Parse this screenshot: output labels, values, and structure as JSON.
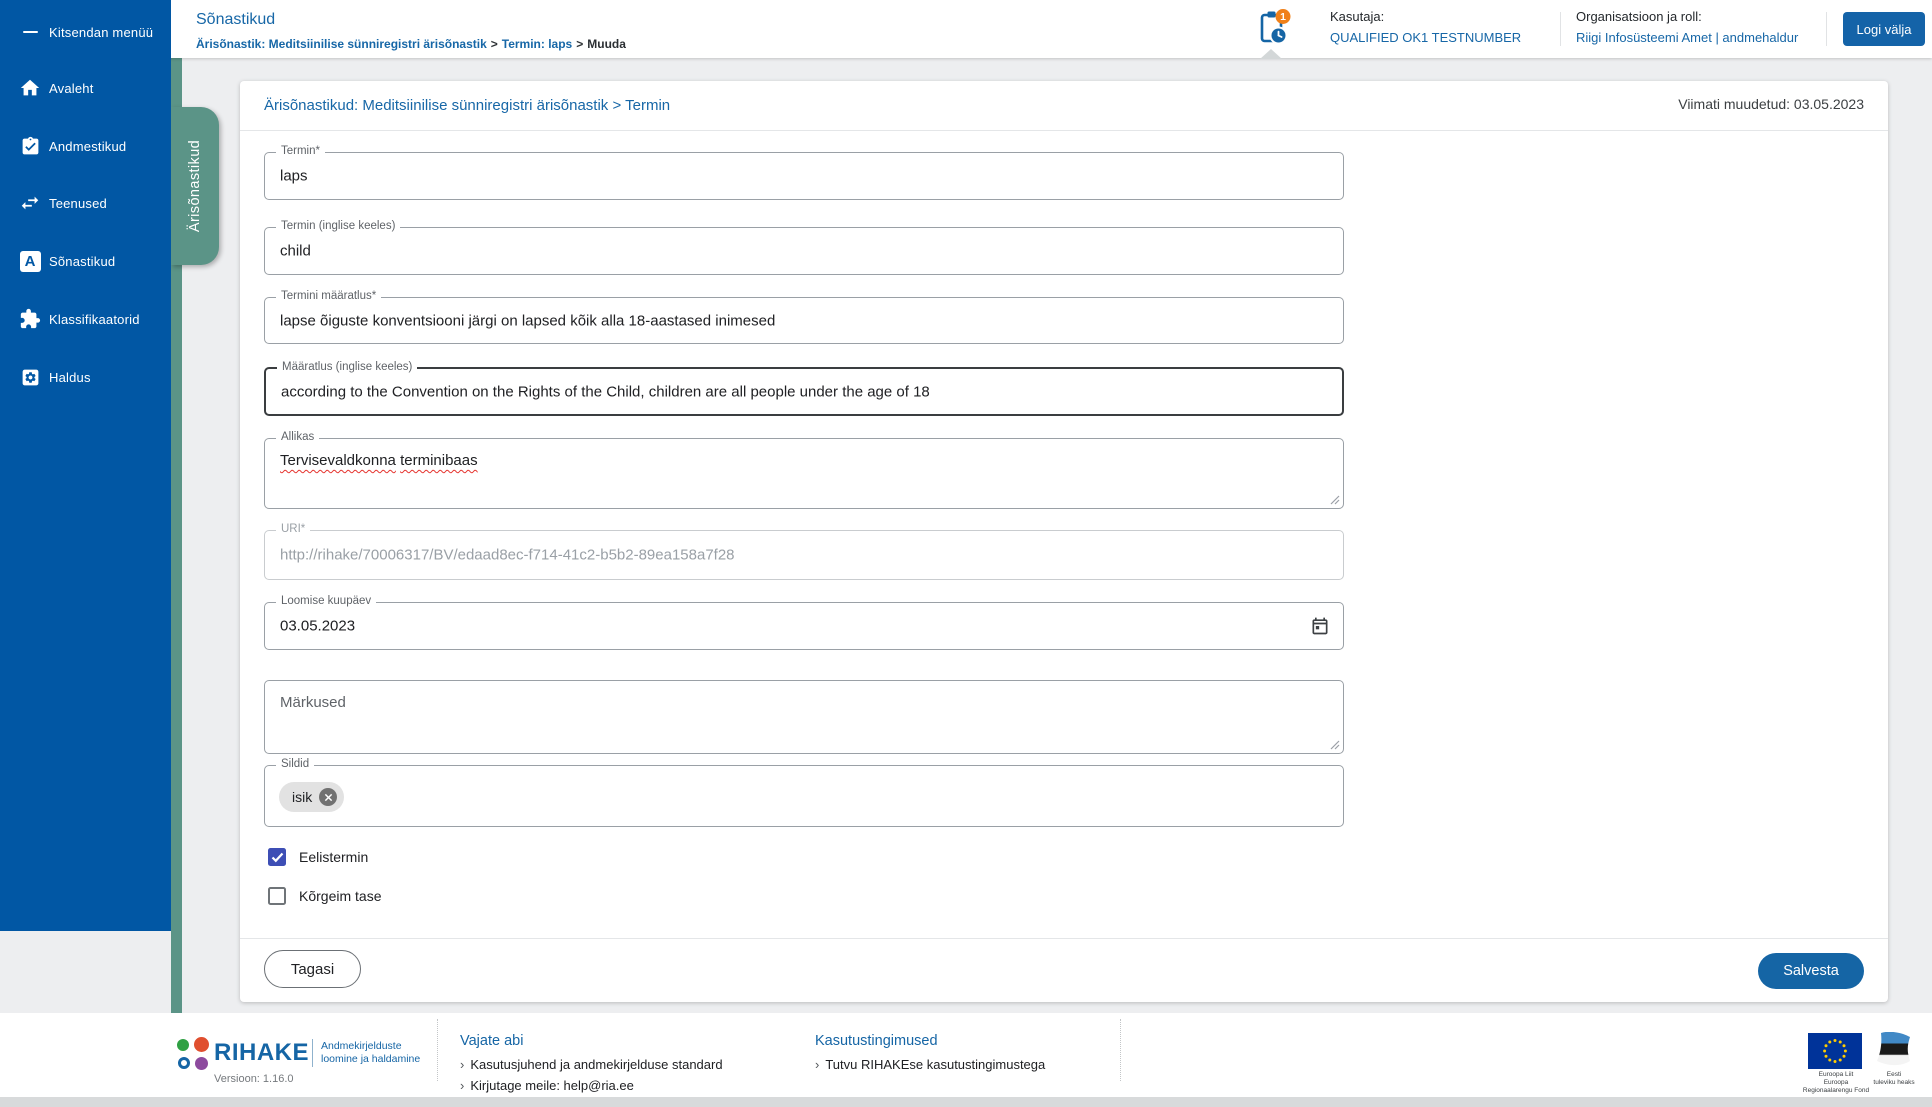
{
  "colors": {
    "sidebar_blue": "#0157a4",
    "link_blue": "#1767a7",
    "green_tab": "#5b9487",
    "checkbox_indigo": "#3d4eb5",
    "badge_orange": "#f08019"
  },
  "header": {
    "title": "Sõnastikud",
    "breadcrumb": [
      {
        "label": "Ärisõnastik: Meditsiinilise sünniregistri ärisõnastik"
      },
      {
        "label": "Termin: laps"
      },
      {
        "label": "Muuda"
      }
    ],
    "breadcrumb_separator": ">",
    "notification_badge": "1",
    "user_label": "Kasutaja:",
    "user_name": "QUALIFIED OK1 TESTNUMBER",
    "org_label": "Organisatsioon ja roll:",
    "org_value": "Riigi Infosüsteemi Amet | andmehaldur",
    "logout_label": "Logi välja"
  },
  "sidebar": {
    "items": [
      {
        "label": "Kitsendan menüü",
        "icon": "collapse-menu-icon"
      },
      {
        "label": "Avaleht",
        "icon": "home-icon"
      },
      {
        "label": "Andmestikud",
        "icon": "clipboard-check-icon"
      },
      {
        "label": "Teenused",
        "icon": "swap-arrows-icon"
      },
      {
        "label": "Sõnastikud",
        "icon": "letter-a-icon"
      },
      {
        "label": "Klassifikaatorid",
        "icon": "puzzle-icon"
      },
      {
        "label": "Haldus",
        "icon": "gear-icon"
      }
    ],
    "active_tab": "Ärisõnastikud",
    "letter_a_glyph": "A"
  },
  "main": {
    "heading": "Ärisõnastikud: Meditsiinilise sünniregistri ärisõnastik > Termin",
    "last_modified": "Viimati muudetud: 03.05.2023",
    "fields": {
      "termin": {
        "label": "Termin*",
        "value": "laps"
      },
      "termin_en": {
        "label": "Termin (inglise keeles)",
        "value": "child"
      },
      "maaratlus": {
        "label": "Termini määratlus*",
        "value": "lapse õiguste konventsiooni järgi on lapsed kõik alla 18-aastased inimesed"
      },
      "maaratlus_en": {
        "label": "Määratlus (inglise keeles)",
        "value": "according to the Convention on the Rights of the Child, children are all people under the age of 18"
      },
      "allikas": {
        "label": "Allikas",
        "words": [
          "Tervisevaldkonna",
          "terminibaas"
        ]
      },
      "uri": {
        "label": "URI*",
        "value": "http://rihake/70006317/BV/edaad8ec-f714-41c2-b5b2-89ea158a7f28"
      },
      "loomise_kuupaev": {
        "label": "Loomise kuupäev",
        "value": "03.05.2023"
      },
      "markused": {
        "placeholder": "Märkused"
      },
      "sildid": {
        "label": "Sildid",
        "chips": [
          {
            "text": "isik"
          }
        ]
      }
    },
    "checkboxes": [
      {
        "label": "Eelistermin",
        "checked": true
      },
      {
        "label": "Kõrgeim tase",
        "checked": false
      }
    ],
    "buttons": {
      "back": "Tagasi",
      "save": "Salvesta"
    }
  },
  "footer": {
    "brand": "RIHAKE",
    "tagline_line1": "Andmekirjelduste",
    "tagline_line2": "loomine ja haldamine",
    "version": "Versioon: 1.16.0",
    "link_arrow": "›",
    "help": {
      "heading": "Vajate abi",
      "links": [
        "Kasutusjuhend ja andmekirjelduse standard",
        "Kirjutage meile: help@ria.ee"
      ]
    },
    "terms": {
      "heading": "Kasutustingimused",
      "links": [
        "Tutvu RIHAKEse kasutustingimustega"
      ]
    },
    "eu_flag_caption": {
      "line1": "Euroopa Liit",
      "line2": "Euroopa",
      "line3": "Regionaalarengu Fond"
    },
    "ee_flag_caption": {
      "line1": "Eesti",
      "line2": "tuleviku heaks"
    }
  }
}
